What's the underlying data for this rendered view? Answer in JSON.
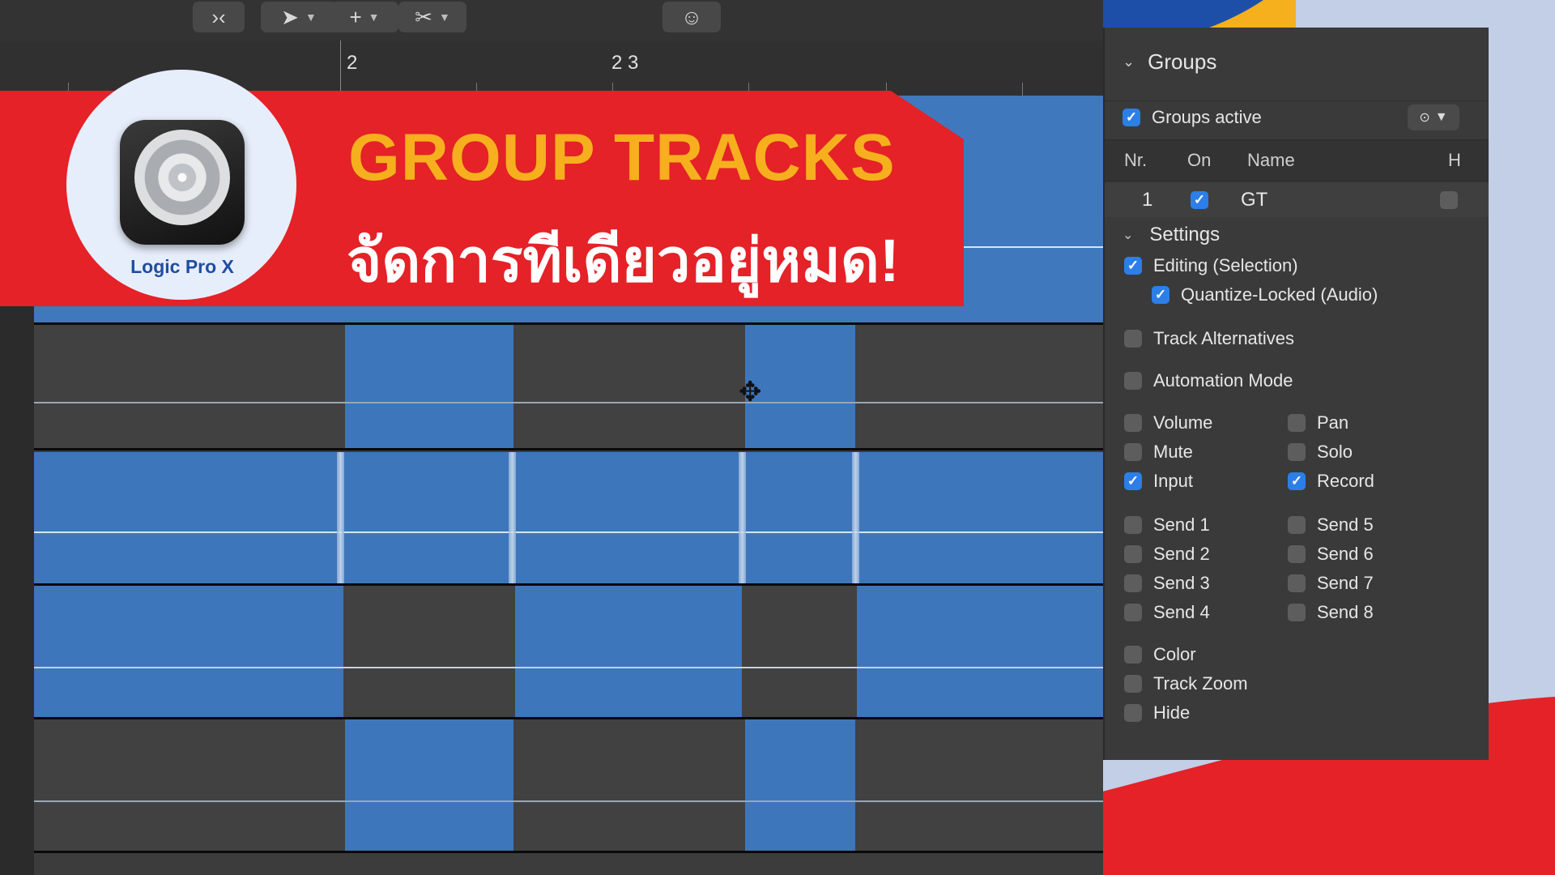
{
  "thumbnail": {
    "title_en": "GROUP TRACKS",
    "title_th": "จัดการทีเดียวอยู่หมด!",
    "logo_caption": "Logic Pro X",
    "colors": {
      "red": "#e42227",
      "yellow": "#f6b01d",
      "blue": "#1e4fa8",
      "light_blue": "#c3cfe6"
    }
  },
  "toolbar": {
    "pointer_tool_icon": "arrow-pointer-icon",
    "pencil_tool_icon": "plus-crosshair-icon",
    "scissors_tool_icon": "scissors-icon"
  },
  "ruler": {
    "bars": [
      "2",
      "2 3"
    ]
  },
  "groups_panel": {
    "header": "Groups",
    "groups_active_label": "Groups active",
    "groups_active": true,
    "columns": {
      "nr": "Nr.",
      "on": "On",
      "name": "Name",
      "hide": "H"
    },
    "group_row": {
      "nr": "1",
      "on": true,
      "name": "GT",
      "hidden": false
    },
    "settings_header": "Settings",
    "settings": {
      "editing": {
        "label": "Editing (Selection)",
        "checked": true
      },
      "quantize_locked": {
        "label": "Quantize-Locked (Audio)",
        "checked": true
      },
      "track_alternatives": {
        "label": "Track Alternatives",
        "checked": false
      },
      "automation_mode": {
        "label": "Automation Mode",
        "checked": false
      },
      "volume": {
        "label": "Volume",
        "checked": false
      },
      "pan": {
        "label": "Pan",
        "checked": false
      },
      "mute": {
        "label": "Mute",
        "checked": false
      },
      "solo": {
        "label": "Solo",
        "checked": false
      },
      "input": {
        "label": "Input",
        "checked": true
      },
      "record": {
        "label": "Record",
        "checked": true
      },
      "send1": {
        "label": "Send 1",
        "checked": false
      },
      "send2": {
        "label": "Send 2",
        "checked": false
      },
      "send3": {
        "label": "Send 3",
        "checked": false
      },
      "send4": {
        "label": "Send 4",
        "checked": false
      },
      "send5": {
        "label": "Send 5",
        "checked": false
      },
      "send6": {
        "label": "Send 6",
        "checked": false
      },
      "send7": {
        "label": "Send 7",
        "checked": false
      },
      "send8": {
        "label": "Send 8",
        "checked": false
      },
      "color": {
        "label": "Color",
        "checked": false
      },
      "track_zoom": {
        "label": "Track Zoom",
        "checked": false
      },
      "hide": {
        "label": "Hide",
        "checked": false
      }
    }
  }
}
